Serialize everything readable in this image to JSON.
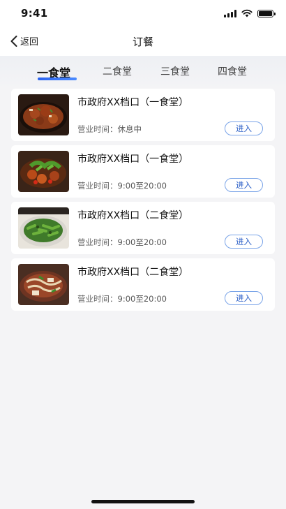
{
  "status_bar": {
    "time": "9:41"
  },
  "nav": {
    "back_label": "返回",
    "title": "订餐"
  },
  "tabs": [
    {
      "label": "一食堂",
      "active": true
    },
    {
      "label": "二食堂",
      "active": false
    },
    {
      "label": "三食堂",
      "active": false
    },
    {
      "label": "四食堂",
      "active": false
    }
  ],
  "canteens": [
    {
      "title": "市政府XX档口（一食堂）",
      "hours_label": "营业时间：",
      "hours_value": "休息中",
      "enter_label": "进入",
      "image": "braised-meat-dish"
    },
    {
      "title": "市政府XX档口（一食堂）",
      "hours_label": "营业时间：",
      "hours_value": "9:00至20:00",
      "enter_label": "进入",
      "image": "stir-fry-greens-dish"
    },
    {
      "title": "市政府XX档口（二食堂）",
      "hours_label": "营业时间：",
      "hours_value": "9:00至20:00",
      "enter_label": "进入",
      "image": "green-pepper-dish"
    },
    {
      "title": "市政府XX档口（二食堂）",
      "hours_label": "营业时间：",
      "hours_value": "9:00至20:00",
      "enter_label": "进入",
      "image": "noodle-stew-dish"
    }
  ],
  "colors": {
    "accent": "#2b63f0",
    "button_border": "#7aa4e8",
    "background": "#f4f4f6"
  }
}
